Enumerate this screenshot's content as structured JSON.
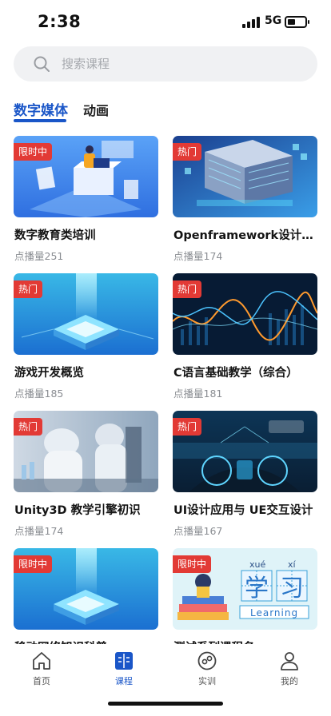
{
  "status_bar": {
    "time": "2:38",
    "network": "5G"
  },
  "search": {
    "placeholder": "搜索课程"
  },
  "tabs": [
    {
      "label": "数字媒体",
      "active": true
    },
    {
      "label": "动画",
      "active": false
    }
  ],
  "courses": [
    {
      "title": "数字教育类培训",
      "views": "点播量251",
      "badge": "限时中",
      "image": "isometric-office-illustration"
    },
    {
      "title": "Openframework设计应用",
      "views": "点播量174",
      "badge": "热门",
      "image": "server-rack-illustration"
    },
    {
      "title": "游戏开发概览",
      "views": "点播量185",
      "badge": "热门",
      "image": "glowing-chip-platform"
    },
    {
      "title": "C语言基础教学（综合）",
      "views": "点播量181",
      "badge": "热门",
      "image": "data-wave-chart"
    },
    {
      "title": "Unity3D 教学引擎初识",
      "views": "点播量174",
      "badge": "热门",
      "image": "lab-scientists-photo"
    },
    {
      "title": "UI设计应用与 UE交互设计",
      "views": "点播量167",
      "badge": "热门",
      "image": "self-driving-car-hud"
    },
    {
      "title": "移动网络知识科普",
      "views": "",
      "badge": "限时中",
      "image": "glowing-chip-platform"
    },
    {
      "title": "测试系列课程名",
      "views": "",
      "badge": "限时中",
      "image": "learning-books-illustration",
      "art_text": {
        "pinyin1": "xué",
        "pinyin2": "xí",
        "hanzi": "学习",
        "english": "Learning"
      }
    }
  ],
  "bottom_nav": [
    {
      "label": "首页",
      "icon": "home-icon",
      "active": false
    },
    {
      "label": "课程",
      "icon": "course-icon",
      "active": true
    },
    {
      "label": "实训",
      "icon": "training-icon",
      "active": false
    },
    {
      "label": "我的",
      "icon": "profile-icon",
      "active": false
    }
  ],
  "colors": {
    "accent": "#1a56c8",
    "badge": "#e23a35",
    "search_bg": "#f0f1f3"
  }
}
